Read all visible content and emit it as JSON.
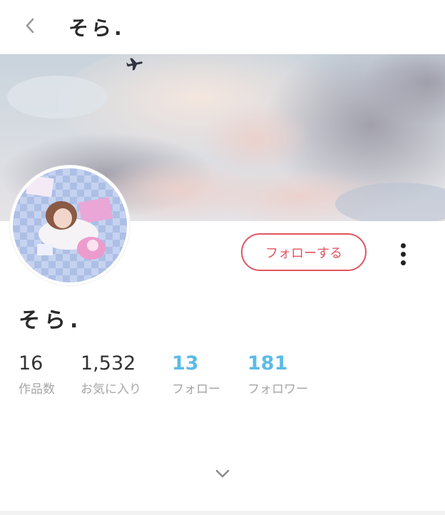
{
  "header": {
    "back_icon": "chevron-left-icon",
    "title": "そら."
  },
  "profile": {
    "name": "そら.",
    "follow_label": "フォローする",
    "more_icon": "vertical-dots-icon",
    "accent_color": "#e05563",
    "link_color": "#5bbbe7"
  },
  "stats": [
    {
      "value": "16",
      "label": "作品数"
    },
    {
      "value": "1,532",
      "label": "お気に入り"
    },
    {
      "value": "13",
      "label": "フォロー"
    },
    {
      "value": "181",
      "label": "フォロワー"
    }
  ],
  "expand_icon": "chevron-down-icon"
}
